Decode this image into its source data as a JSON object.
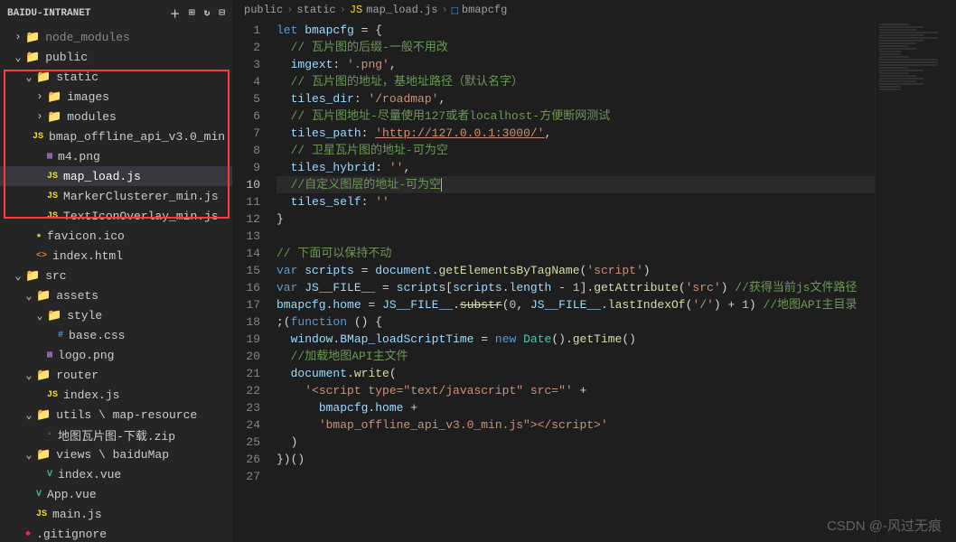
{
  "sidebar": {
    "title": "BAIDU-INTRANET",
    "items": [
      {
        "indent": 12,
        "chevron": "›",
        "icon": "folder",
        "iconClass": "folder-icon",
        "label": "node_modules",
        "color": "#888"
      },
      {
        "indent": 12,
        "chevron": "⌄",
        "icon": "folder",
        "iconClass": "folder-icon",
        "label": "public",
        "color": "#ccc"
      },
      {
        "indent": 24,
        "chevron": "⌄",
        "icon": "folder",
        "iconClass": "folder-icon",
        "label": "static",
        "color": "#ccc"
      },
      {
        "indent": 36,
        "chevron": "›",
        "icon": "folder",
        "iconClass": "folder-icon",
        "label": "images",
        "color": "#ccc"
      },
      {
        "indent": 36,
        "chevron": "›",
        "icon": "folder",
        "iconClass": "folder-icon",
        "label": "modules",
        "color": "#ccc"
      },
      {
        "indent": 36,
        "chevron": "",
        "icon": "JS",
        "iconClass": "js-icon",
        "label": "bmap_offline_api_v3.0_min.js",
        "color": "#ccc"
      },
      {
        "indent": 36,
        "chevron": "",
        "icon": "▩",
        "iconClass": "png-icon",
        "label": "m4.png",
        "color": "#ccc"
      },
      {
        "indent": 36,
        "chevron": "",
        "icon": "JS",
        "iconClass": "js-icon",
        "label": "map_load.js",
        "color": "#fff",
        "selected": true
      },
      {
        "indent": 36,
        "chevron": "",
        "icon": "JS",
        "iconClass": "js-icon",
        "label": "MarkerClusterer_min.js",
        "color": "#ccc"
      },
      {
        "indent": 36,
        "chevron": "",
        "icon": "JS",
        "iconClass": "js-icon",
        "label": "TextIconOverlay_min.js",
        "color": "#ccc"
      },
      {
        "indent": 24,
        "chevron": "",
        "icon": "★",
        "iconClass": "ico-icon",
        "label": "favicon.ico",
        "color": "#ccc"
      },
      {
        "indent": 24,
        "chevron": "",
        "icon": "<>",
        "iconClass": "html-icon",
        "label": "index.html",
        "color": "#ccc"
      },
      {
        "indent": 12,
        "chevron": "⌄",
        "icon": "folder",
        "iconClass": "folder-icon",
        "label": "src",
        "color": "#ccc"
      },
      {
        "indent": 24,
        "chevron": "⌄",
        "icon": "folder",
        "iconClass": "folder-icon",
        "label": "assets",
        "color": "#ccc"
      },
      {
        "indent": 36,
        "chevron": "⌄",
        "icon": "folder",
        "iconClass": "folder-icon",
        "label": "style",
        "color": "#ccc"
      },
      {
        "indent": 48,
        "chevron": "",
        "icon": "#",
        "iconClass": "css-icon",
        "label": "base.css",
        "color": "#ccc"
      },
      {
        "indent": 36,
        "chevron": "",
        "icon": "▩",
        "iconClass": "png-icon",
        "label": "logo.png",
        "color": "#ccc"
      },
      {
        "indent": 24,
        "chevron": "⌄",
        "icon": "folder",
        "iconClass": "folder-icon",
        "label": "router",
        "color": "#ccc"
      },
      {
        "indent": 36,
        "chevron": "",
        "icon": "JS",
        "iconClass": "js-icon",
        "label": "index.js",
        "color": "#ccc"
      },
      {
        "indent": 24,
        "chevron": "⌄",
        "icon": "folder",
        "iconClass": "folder-icon",
        "label": "utils \\ map-resource",
        "color": "#ccc"
      },
      {
        "indent": 36,
        "chevron": "",
        "icon": "▫",
        "iconClass": "zip-icon",
        "label": "地图瓦片图-下载.zip",
        "color": "#ccc"
      },
      {
        "indent": 24,
        "chevron": "⌄",
        "icon": "folder",
        "iconClass": "folder-icon",
        "label": "views \\ baiduMap",
        "color": "#ccc"
      },
      {
        "indent": 36,
        "chevron": "",
        "icon": "V",
        "iconClass": "vue-icon",
        "label": "index.vue",
        "color": "#ccc"
      },
      {
        "indent": 24,
        "chevron": "",
        "icon": "V",
        "iconClass": "vue-icon",
        "label": "App.vue",
        "color": "#ccc"
      },
      {
        "indent": 24,
        "chevron": "",
        "icon": "JS",
        "iconClass": "js-icon",
        "label": "main.js",
        "color": "#ccc"
      },
      {
        "indent": 12,
        "chevron": "",
        "icon": "◆",
        "iconClass": "gitignore-icon",
        "label": ".gitignore",
        "color": "#ccc"
      }
    ]
  },
  "breadcrumb": {
    "items": [
      "public",
      "static",
      "map_load.js",
      "bmapcfg"
    ]
  },
  "editor": {
    "active_line": 10,
    "lines": [
      {
        "n": 1,
        "html": "<span class='tok-keyword'>let</span> <span class='tok-var'>bmapcfg</span> <span class='tok-punct'>=</span> <span class='tok-punct'>{</span>"
      },
      {
        "n": 2,
        "html": "  <span class='tok-comment'>// 瓦片图的后缀-一般不用改</span>"
      },
      {
        "n": 3,
        "html": "  <span class='tok-prop'>imgext</span><span class='tok-punct'>:</span> <span class='tok-string'>'.png'</span><span class='tok-punct'>,</span>"
      },
      {
        "n": 4,
        "html": "  <span class='tok-comment'>// 瓦片图的地址，基地址路径（默认名字）</span>"
      },
      {
        "n": 5,
        "html": "  <span class='tok-prop'>tiles_dir</span><span class='tok-punct'>:</span> <span class='tok-string'>'/roadmap'</span><span class='tok-punct'>,</span>"
      },
      {
        "n": 6,
        "html": "  <span class='tok-comment'>// 瓦片图地址-尽量使用127或者localhost-方便断网测试</span>"
      },
      {
        "n": 7,
        "html": "  <span class='tok-prop'>tiles_path</span><span class='tok-punct'>:</span> <span class='tok-url'>'http://127.0.0.1:3000/'</span><span class='tok-punct'>,</span>"
      },
      {
        "n": 8,
        "html": "  <span class='tok-comment'>// 卫星瓦片图的地址-可为空</span>"
      },
      {
        "n": 9,
        "html": "  <span class='tok-prop'>tiles_hybrid</span><span class='tok-punct'>:</span> <span class='tok-string'>''</span><span class='tok-punct'>,</span>"
      },
      {
        "n": 10,
        "html": "  <span class='tok-comment'>//自定义图层的地址-可为空</span><span class='cursor-caret'></span>"
      },
      {
        "n": 11,
        "html": "  <span class='tok-prop'>tiles_self</span><span class='tok-punct'>:</span> <span class='tok-string'>''</span>"
      },
      {
        "n": 12,
        "html": "<span class='tok-punct'>}</span>"
      },
      {
        "n": 13,
        "html": ""
      },
      {
        "n": 14,
        "html": "<span class='tok-comment'>// 下面可以保持不动</span>"
      },
      {
        "n": 15,
        "html": "<span class='tok-keyword'>var</span> <span class='tok-var'>scripts</span> <span class='tok-punct'>=</span> <span class='tok-var'>document</span><span class='tok-punct'>.</span><span class='tok-func'>getElementsByTagName</span><span class='tok-punct'>(</span><span class='tok-string'>'script'</span><span class='tok-punct'>)</span>"
      },
      {
        "n": 16,
        "html": "<span class='tok-keyword'>var</span> <span class='tok-var'>JS__FILE__</span> <span class='tok-punct'>=</span> <span class='tok-var'>scripts</span><span class='tok-punct'>[</span><span class='tok-var'>scripts</span><span class='tok-punct'>.</span><span class='tok-prop'>length</span> <span class='tok-punct'>-</span> <span class='tok-num'>1</span><span class='tok-punct'>].</span><span class='tok-func'>getAttribute</span><span class='tok-punct'>(</span><span class='tok-string'>'src'</span><span class='tok-punct'>)</span> <span class='tok-comment'>//获得当前js文件路径</span>"
      },
      {
        "n": 17,
        "html": "<span class='tok-var'>bmapcfg</span><span class='tok-punct'>.</span><span class='tok-prop'>home</span> <span class='tok-punct'>=</span> <span class='tok-var'>JS__FILE__</span><span class='tok-punct'>.</span><span class='tok-func tok-strike'>substr</span><span class='tok-punct'>(</span><span class='tok-num'>0</span><span class='tok-punct'>,</span> <span class='tok-var'>JS__FILE__</span><span class='tok-punct'>.</span><span class='tok-func'>lastIndexOf</span><span class='tok-punct'>(</span><span class='tok-string'>'/'</span><span class='tok-punct'>) +</span> <span class='tok-num'>1</span><span class='tok-punct'>)</span> <span class='tok-comment'>//地图API主目录</span>"
      },
      {
        "n": 18,
        "html": "<span class='tok-punct'>;(</span><span class='tok-keyword'>function</span> <span class='tok-punct'>() {</span>"
      },
      {
        "n": 19,
        "html": "  <span class='tok-var'>window</span><span class='tok-punct'>.</span><span class='tok-prop'>BMap_loadScriptTime</span> <span class='tok-punct'>=</span> <span class='tok-keyword'>new</span> <span class='tok-type'>Date</span><span class='tok-punct'>().</span><span class='tok-func'>getTime</span><span class='tok-punct'>()</span>"
      },
      {
        "n": 20,
        "html": "  <span class='tok-comment'>//加载地图API主文件</span>"
      },
      {
        "n": 21,
        "html": "  <span class='tok-var'>document</span><span class='tok-punct'>.</span><span class='tok-func'>write</span><span class='tok-punct'>(</span>"
      },
      {
        "n": 22,
        "html": "    <span class='tok-string'>'&lt;script type=\"text/javascript\" src=\"'</span> <span class='tok-punct'>+</span>"
      },
      {
        "n": 23,
        "html": "      <span class='tok-var'>bmapcfg</span><span class='tok-punct'>.</span><span class='tok-prop'>home</span> <span class='tok-punct'>+</span>"
      },
      {
        "n": 24,
        "html": "      <span class='tok-string'>'bmap_offline_api_v3.0_min.js\"&gt;&lt;/script&gt;'</span>"
      },
      {
        "n": 25,
        "html": "  <span class='tok-punct'>)</span>"
      },
      {
        "n": 26,
        "html": "<span class='tok-punct'>})()</span>"
      },
      {
        "n": 27,
        "html": ""
      }
    ]
  },
  "watermark": "CSDN @-风过无痕"
}
